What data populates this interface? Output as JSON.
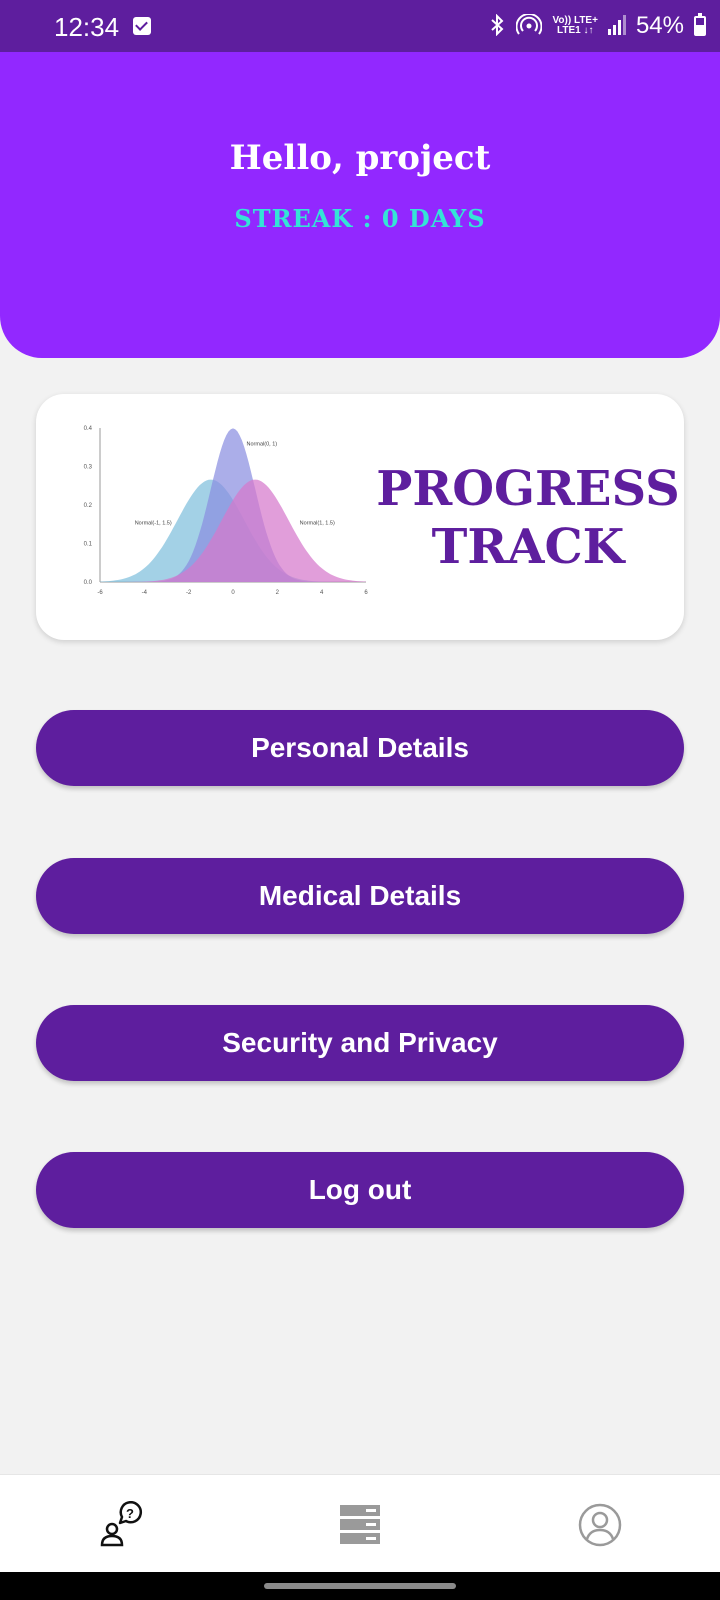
{
  "status_bar": {
    "time": "12:34",
    "notification_icon": "check-box-icon",
    "icons": [
      "bluetooth-icon",
      "hotspot-icon",
      "volte-icon",
      "signal-icon"
    ],
    "volte_line1": "Vo)) LTE+",
    "volte_line2": "LTE1 ↓↑",
    "battery_percent": "54%",
    "battery_level": 0.54
  },
  "header": {
    "greeting": "Hello, project",
    "streak": "STREAK : 0 DAYS",
    "background_color": "#9228ff",
    "streak_color": "#34e4d6"
  },
  "banner": {
    "title_line1": "PROGRESS",
    "title_line2": "TRACK",
    "title_color": "#5e1e9e"
  },
  "chart_data": {
    "type": "area",
    "x_ticks": [
      "-6",
      "-4",
      "-2",
      "0",
      "2",
      "4",
      "6"
    ],
    "y_ticks": [
      "0.0",
      "0.1",
      "0.2",
      "0.3",
      "0.4"
    ],
    "xlim": [
      -6,
      6
    ],
    "ylim": [
      0,
      0.4
    ],
    "series": [
      {
        "name": "Normal(-1, 1.5)",
        "mean": -1,
        "sd": 1.5,
        "color": "#7fbfdc"
      },
      {
        "name": "Normal(0, 1)",
        "mean": 0,
        "sd": 1,
        "color": "#8a8fe0"
      },
      {
        "name": "Normal(1, 1.5)",
        "mean": 1,
        "sd": 1.5,
        "color": "#d678cc"
      }
    ]
  },
  "menu": {
    "personal": "Personal Details",
    "medical": "Medical Details",
    "security": "Security and Privacy",
    "logout": "Log out",
    "button_color": "#5e1e9e"
  },
  "bottom_nav": {
    "items": [
      "help-chat-icon",
      "storage-icon",
      "profile-icon"
    ]
  }
}
